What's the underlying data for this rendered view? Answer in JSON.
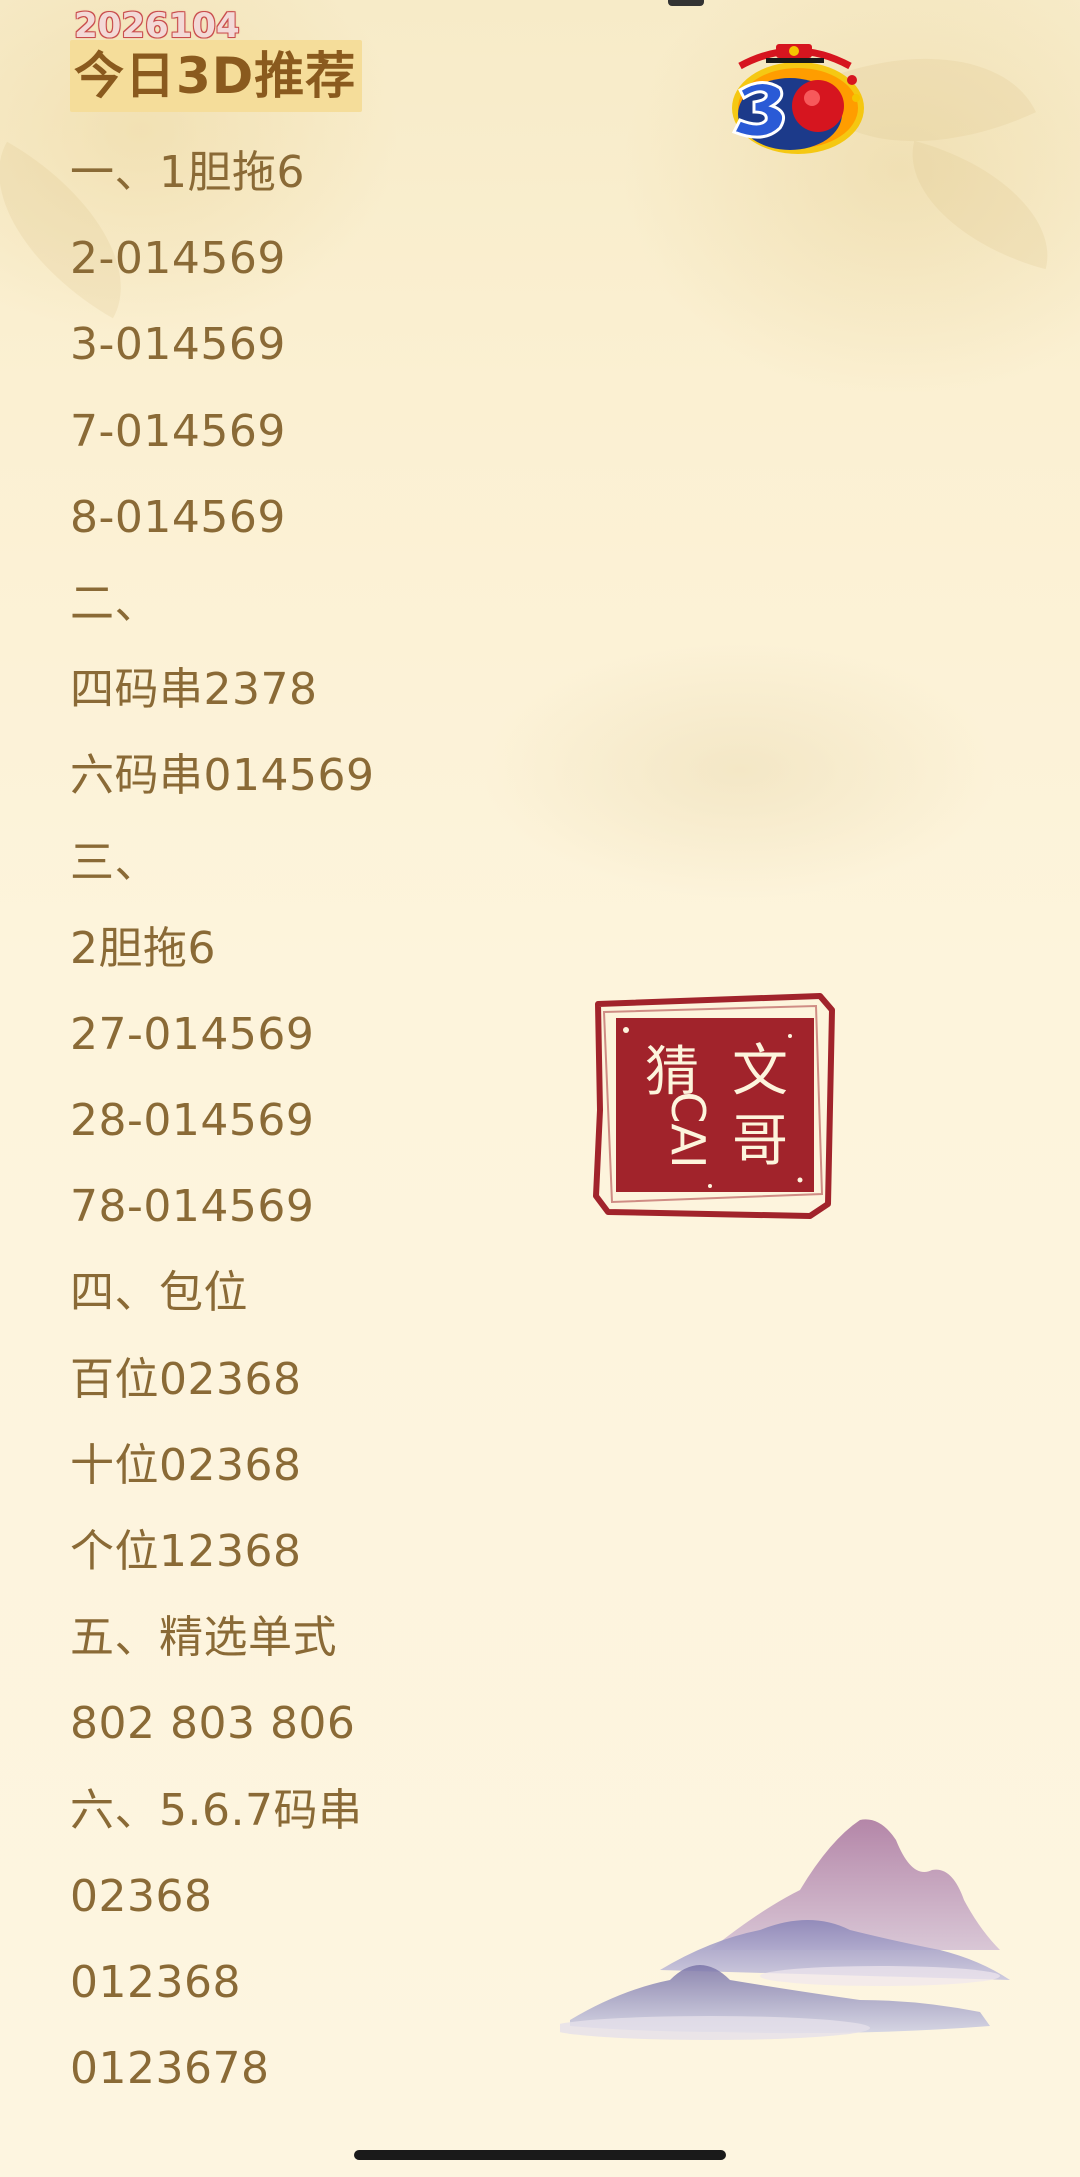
{
  "header": {
    "date_stamp": "2026104",
    "title": "今日3D推荐"
  },
  "content": {
    "lines": [
      "一、1胆拖6",
      "2-014569",
      "3-014569",
      "7-014569",
      "8-014569",
      "二、",
      "四码串2378",
      "六码串014569",
      "三、",
      "2胆拖6",
      "27-014569",
      "28-014569",
      "78-014569",
      "四、包位",
      "百位02368",
      "十位02368",
      "个位12368",
      "五、精选单式",
      "802 803 806",
      "六、5.6.7码串",
      "02368",
      "012368",
      "0123678"
    ]
  },
  "seal": {
    "chars": [
      "文",
      "哥",
      "猜",
      "CAI"
    ]
  },
  "colors": {
    "text": "#8a6a36",
    "title": "#8a5a1e",
    "title_highlight": "#f5dd9a",
    "seal_red": "#a1232b",
    "date_stamp": "#c94d4d"
  },
  "icons": {
    "logo": "lottery-3d-logo-icon",
    "seal": "seal-stamp-icon",
    "decoration": "mountain-landscape-icon"
  }
}
